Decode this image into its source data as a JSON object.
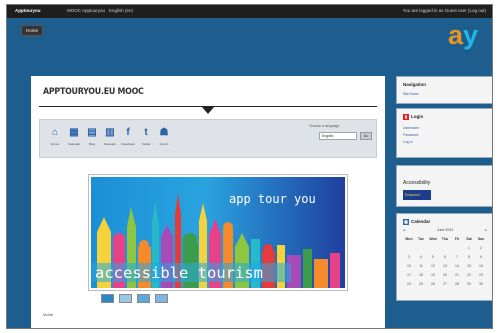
{
  "topbar": {
    "brand": "Apptouryou",
    "menu": [
      "MOOC Apptouryou",
      "English (en)"
    ],
    "user": "You are logged in as Guest user (Log out)"
  },
  "nav_button": "Home",
  "logo": {
    "first": "a",
    "second": "y"
  },
  "course": {
    "title": "APPTOURYOU.EU MOOC",
    "tools": [
      {
        "icon": "home",
        "label": "Home"
      },
      {
        "icon": "calendar",
        "label": "Calendar"
      },
      {
        "icon": "book",
        "label": "Blog"
      },
      {
        "icon": "dictionary",
        "label": "Glossary"
      },
      {
        "icon": "facebook",
        "label": "Facebook"
      },
      {
        "icon": "twitter",
        "label": "Twitter"
      },
      {
        "icon": "forum",
        "label": "Forum"
      }
    ],
    "language_label": "Choose a language",
    "language_value": "English",
    "language_button": "Go",
    "banner": {
      "line1": "app tour you",
      "line2": "accessible tourism"
    },
    "footnote": "Mobile"
  },
  "blocks": {
    "navigation": {
      "title": "Navigation",
      "items": [
        "Site home"
      ]
    },
    "login": {
      "title": "Login",
      "items": [
        "Username",
        "Password",
        "Log in"
      ]
    },
    "accessibility": {
      "title": "Accessibility",
      "logo_text": "Erasmus+"
    },
    "calendar": {
      "title": "Calendar",
      "month": "June 2024",
      "days": [
        "Mon",
        "Tue",
        "Wed",
        "Thu",
        "Fri",
        "Sat",
        "Sun"
      ],
      "weeks": [
        [
          "",
          "",
          "",
          "",
          "",
          "1",
          "2"
        ],
        [
          "3",
          "4",
          "5",
          "6",
          "7",
          "8",
          "9"
        ],
        [
          "10",
          "11",
          "12",
          "13",
          "14",
          "15",
          "16"
        ],
        [
          "17",
          "18",
          "19",
          "20",
          "21",
          "22",
          "23"
        ],
        [
          "24",
          "25",
          "26",
          "27",
          "28",
          "29",
          "30"
        ]
      ]
    }
  },
  "colors": {
    "page_bg": "#1d5e8e",
    "accent_blue": "#2c65a8",
    "logo_orange": "#e89620",
    "logo_cyan": "#22b6e6"
  }
}
